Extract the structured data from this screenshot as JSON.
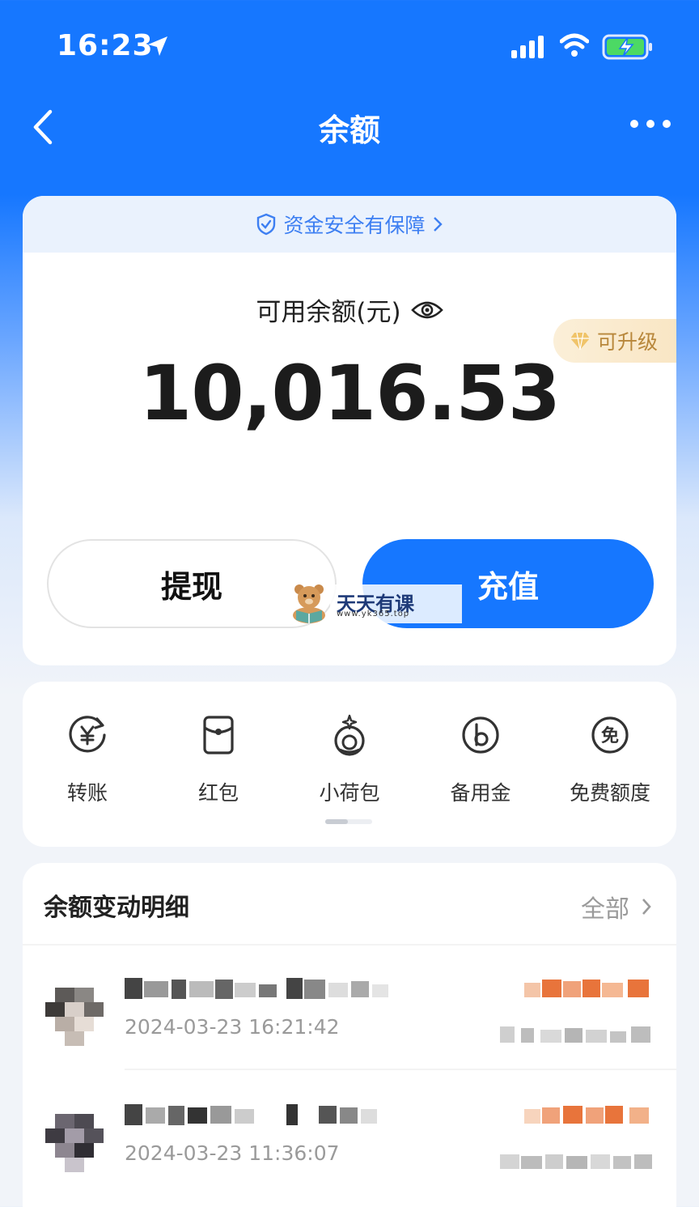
{
  "status_bar": {
    "time": "16:23"
  },
  "nav": {
    "title": "余额"
  },
  "balance_card": {
    "secure_text": "资金安全有保障",
    "available_label": "可用余额(元)",
    "upgrade_label": "可升级",
    "amount": "10,016.53",
    "withdraw_label": "提现",
    "recharge_label": "充值"
  },
  "watermark": {
    "text": "天天有课",
    "url": "www.yk365.top"
  },
  "services": [
    {
      "label": "转账",
      "icon": "transfer-yen-icon"
    },
    {
      "label": "红包",
      "icon": "red-packet-icon"
    },
    {
      "label": "小荷包",
      "icon": "purse-icon"
    },
    {
      "label": "备用金",
      "icon": "reserve-fund-icon"
    },
    {
      "label": "免费额度",
      "icon": "free-quota-icon"
    }
  ],
  "details": {
    "title": "余额变动明细",
    "all_label": "全部",
    "rows": [
      {
        "time": "2024-03-23 16:21:42"
      },
      {
        "time": "2024-03-23 11:36:07"
      }
    ]
  },
  "colors": {
    "brand": "#1677ff",
    "amount_redacted": "#e8743b"
  }
}
